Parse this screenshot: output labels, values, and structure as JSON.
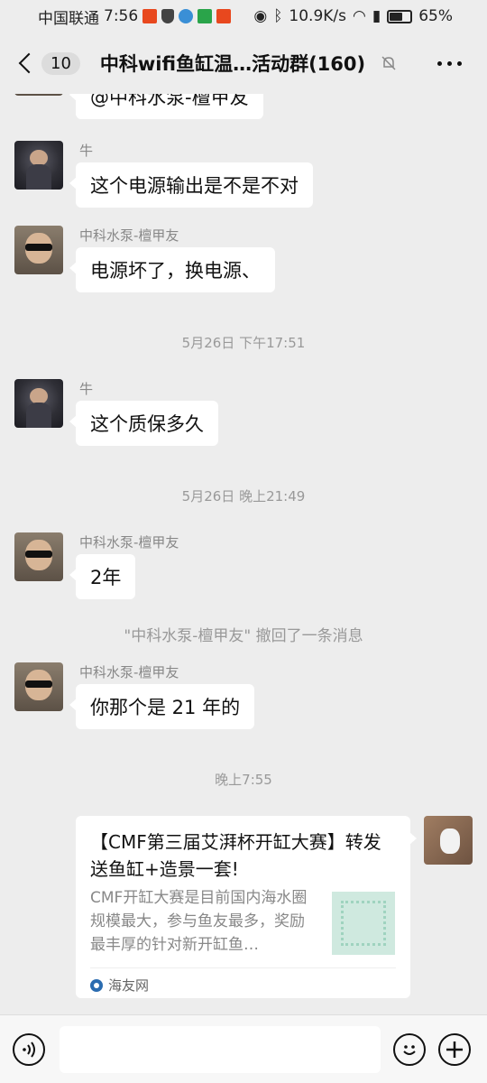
{
  "status": {
    "carrier": "中国联通",
    "time": "7:56",
    "speed": "10.9K/s",
    "battery": "65%",
    "battery_level": 0.65
  },
  "header": {
    "unread_count": "10",
    "title": "中科wifi鱼缸温…活动群(160)"
  },
  "messages": [
    {
      "sender": "",
      "text": "@中科水泵-檀甲友"
    },
    {
      "sender": "牛",
      "text": "这个电源输出是不是不对"
    },
    {
      "sender": "中科水泵-檀甲友",
      "text": "电源坏了，换电源、"
    },
    {
      "time": "5月26日 下午17:51"
    },
    {
      "sender": "牛",
      "text": "这个质保多久"
    },
    {
      "time": "5月26日 晚上21:49"
    },
    {
      "sender": "中科水泵-檀甲友",
      "text": "2年"
    },
    {
      "system": "\"中科水泵-檀甲友\" 撤回了一条消息"
    },
    {
      "sender": "中科水泵-檀甲友",
      "text": "你那个是 21 年的"
    },
    {
      "time": "晚上7:55"
    }
  ],
  "link_card": {
    "title": "【CMF第三届艾湃杯开缸大赛】转发送鱼缸+造景一套!",
    "description": "CMF开缸大赛是目前国内海水圈规模最大，参与鱼友最多，奖励最丰厚的针对新开缸鱼…",
    "source": "海友网"
  },
  "icons": {
    "back": "back-arrow-icon",
    "mute": "bell-muted-icon",
    "more": "more-icon",
    "voice": "voice-icon",
    "emoji": "emoji-icon",
    "plus": "plus-icon"
  }
}
